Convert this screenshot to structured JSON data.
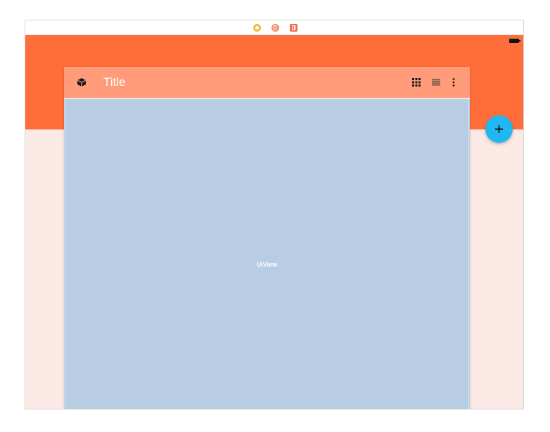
{
  "toolbar": {
    "title": "Title"
  },
  "content": {
    "view_label": "UIView"
  },
  "icons": {
    "scene_dock": [
      "view-controller-icon",
      "first-responder-icon",
      "exit-icon"
    ],
    "status": "battery-icon",
    "toolbar_leading": "cube-icon",
    "toolbar_actions": [
      "grid-view-icon",
      "list-view-icon",
      "more-vertical-icon"
    ],
    "fab": "plus-icon"
  },
  "colors": {
    "header_band": "#ff6d3a",
    "toolbar": "#ff9b79",
    "content_view": "#b8cce4",
    "background": "#fbe9e6",
    "fab": "#1fb8f2",
    "dock_view_controller": "#f0bb3c",
    "dock_first_responder": "#f1916e",
    "dock_exit": "#ea6f4e"
  }
}
